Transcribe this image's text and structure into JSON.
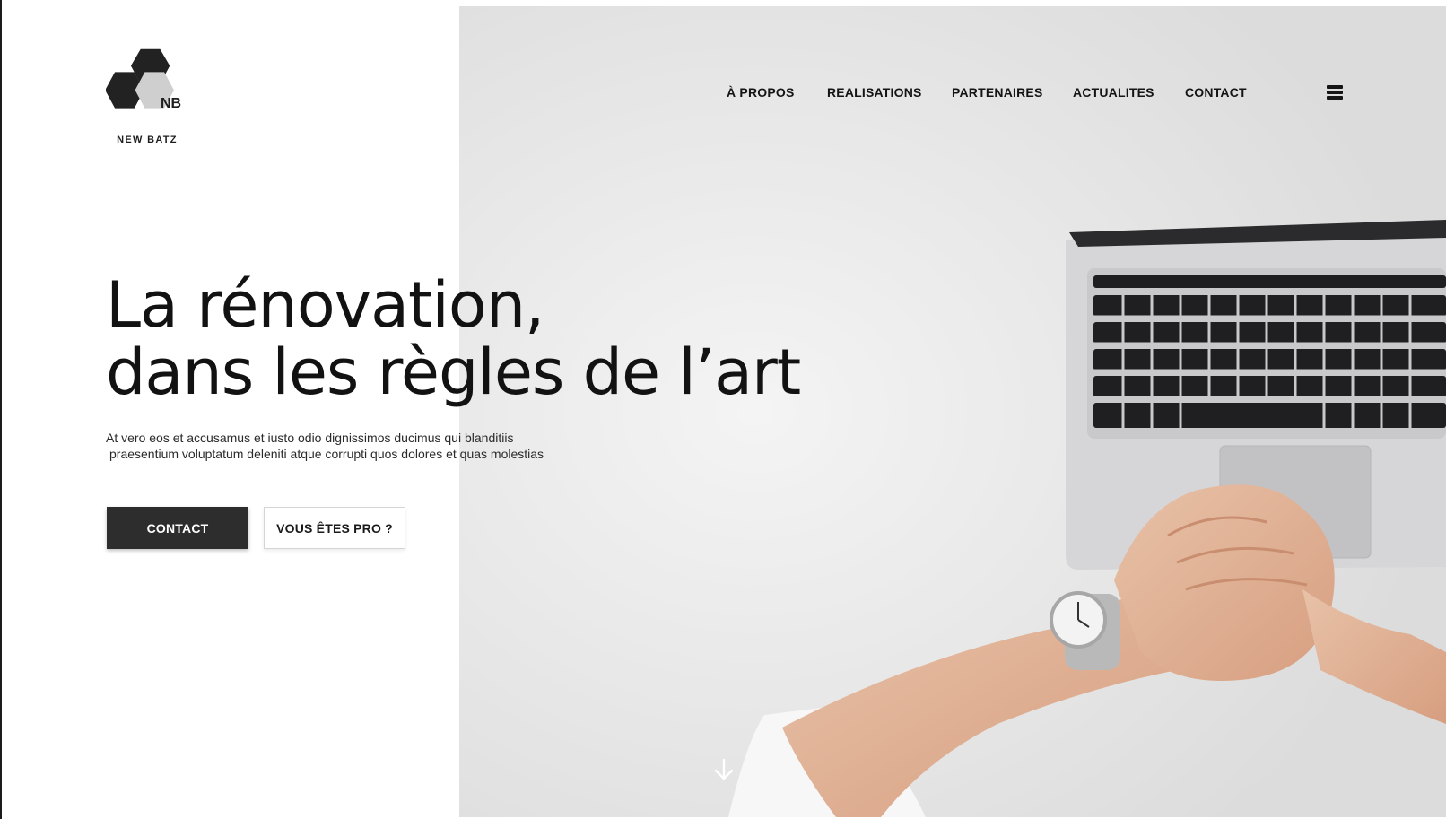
{
  "brand": {
    "logo_initials": "NB",
    "name": "NEW BATZ"
  },
  "nav": {
    "items": [
      {
        "label": "À PROPOS"
      },
      {
        "label": "REALISATIONS"
      },
      {
        "label": "PARTENAIRES"
      },
      {
        "label": "ACTUALITES"
      },
      {
        "label": "CONTACT"
      }
    ],
    "menu_icon": "hamburger-menu-icon"
  },
  "hero": {
    "headline_line1": "La rénovation,",
    "headline_line2": "dans les règles de l’art",
    "subtext_line1": "At vero eos et accusamus et iusto odio dignissimos ducimus qui blanditiis",
    "subtext_line2": "praesentium voluptatum deleniti atque corrupti quos dolores et quas molestias",
    "cta_primary": "CONTACT",
    "cta_secondary": "VOUS ÊTES PRO ?",
    "scroll_icon": "arrow-down-icon",
    "image": "laptop-hands-watch-photo"
  },
  "colors": {
    "dark": "#2d2d2d",
    "logo_hex_light": "#cfcfcf",
    "background": "#ffffff"
  }
}
